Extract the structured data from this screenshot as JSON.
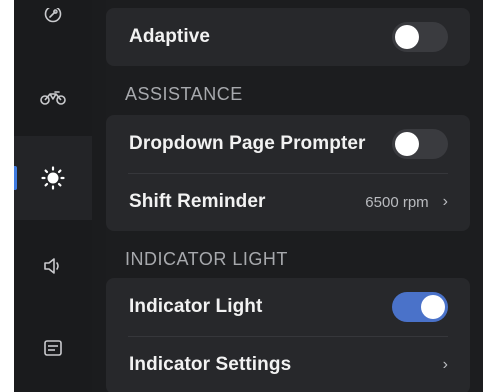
{
  "nav": {
    "items": [
      {
        "name": "settings-rail-item",
        "icon": "wrench-circle-icon"
      },
      {
        "name": "vehicle-rail-item",
        "icon": "motorcycle-icon"
      },
      {
        "name": "display-rail-item",
        "icon": "sun-icon",
        "active": true
      },
      {
        "name": "sound-rail-item",
        "icon": "speaker-icon"
      },
      {
        "name": "general-rail-item",
        "icon": "panel-icon"
      }
    ]
  },
  "main": {
    "adaptive": {
      "label": "Adaptive",
      "enabled": false
    },
    "assistance": {
      "title": "ASSISTANCE",
      "dropdown_prompter": {
        "label": "Dropdown Page Prompter",
        "enabled": false
      },
      "shift_reminder": {
        "label": "Shift Reminder",
        "value": "6500 rpm"
      }
    },
    "indicator": {
      "title": "INDICATOR LIGHT",
      "indicator_light": {
        "label": "Indicator Light",
        "enabled": true
      },
      "indicator_settings": {
        "label": "Indicator Settings"
      }
    }
  },
  "colors": {
    "accent": "#4a72c9",
    "active_indicator": "#3f7be0",
    "background": "#1b1c1e",
    "card": "#27282b"
  },
  "glyphs": {
    "chevron": "›"
  }
}
